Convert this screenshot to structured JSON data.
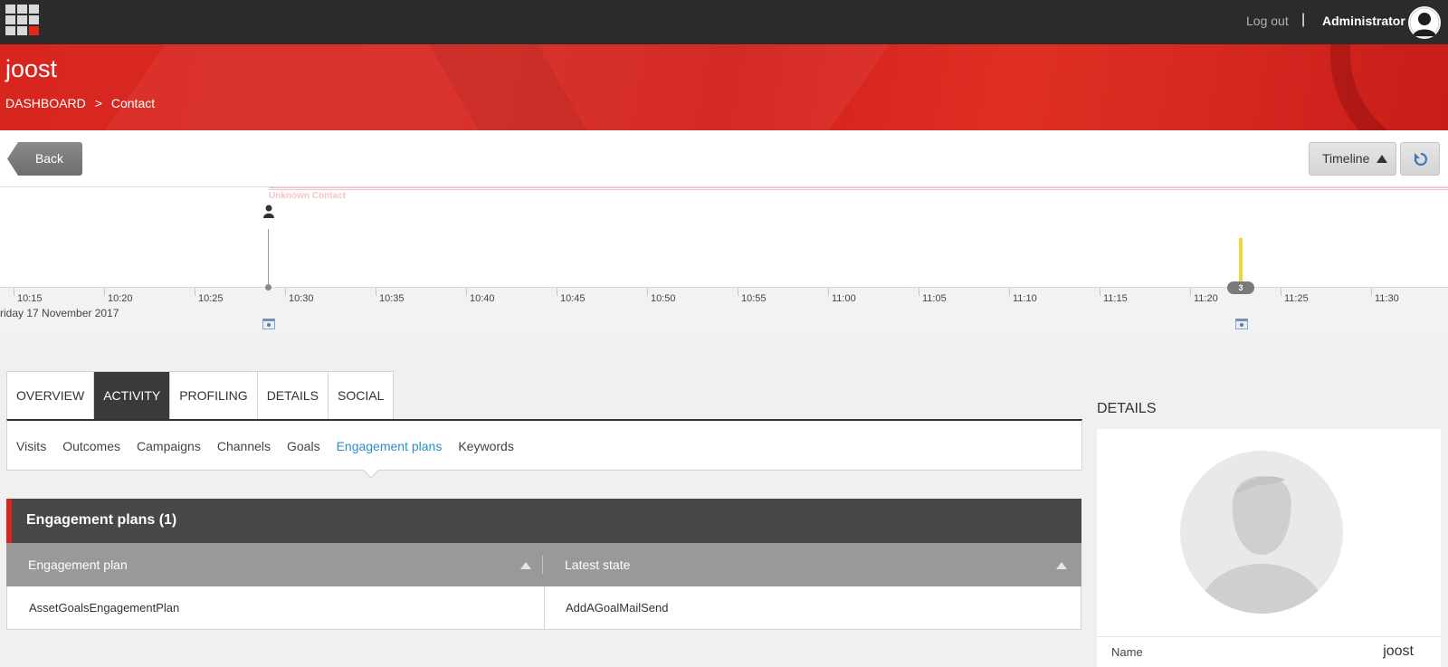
{
  "topbar": {
    "logout_label": "Log out",
    "separator": "|",
    "user_name": "Administrator"
  },
  "banner": {
    "title": "joost",
    "breadcrumb": [
      "DASHBOARD",
      ">",
      "Contact"
    ]
  },
  "toolbar": {
    "back_label": "Back",
    "timeline_label": "Timeline"
  },
  "timeline": {
    "contact_label": "Unknown Contact",
    "ticks": [
      "10:15",
      "10:20",
      "10:25",
      "10:30",
      "10:35",
      "10:40",
      "10:45",
      "10:50",
      "10:55",
      "11:00",
      "11:05",
      "11:10",
      "11:15",
      "11:20",
      "11:25",
      "11:30"
    ],
    "date_label": "riday 17 November 2017",
    "event_count": "3"
  },
  "tabs": [
    {
      "label": "OVERVIEW",
      "active": false
    },
    {
      "label": "ACTIVITY",
      "active": true
    },
    {
      "label": "PROFILING",
      "active": false
    },
    {
      "label": "DETAILS",
      "active": false
    },
    {
      "label": "SOCIAL",
      "active": false
    }
  ],
  "subnav": [
    {
      "label": "Visits",
      "active": false
    },
    {
      "label": "Outcomes",
      "active": false
    },
    {
      "label": "Campaigns",
      "active": false
    },
    {
      "label": "Channels",
      "active": false
    },
    {
      "label": "Goals",
      "active": false
    },
    {
      "label": "Engagement plans",
      "active": true
    },
    {
      "label": "Keywords",
      "active": false
    }
  ],
  "panel": {
    "title": "Engagement plans (1)",
    "columns": [
      "Engagement plan",
      "Latest state"
    ],
    "rows": [
      [
        "AssetGoalsEngagementPlan",
        "AddAGoalMailSend"
      ]
    ]
  },
  "details": {
    "heading": "DETAILS",
    "name_label": "Name",
    "name_value": "joost"
  },
  "colors": {
    "brand_red": "#d8261f",
    "active_link": "#2b8ec7",
    "event_yellow": "#f3d43a"
  }
}
